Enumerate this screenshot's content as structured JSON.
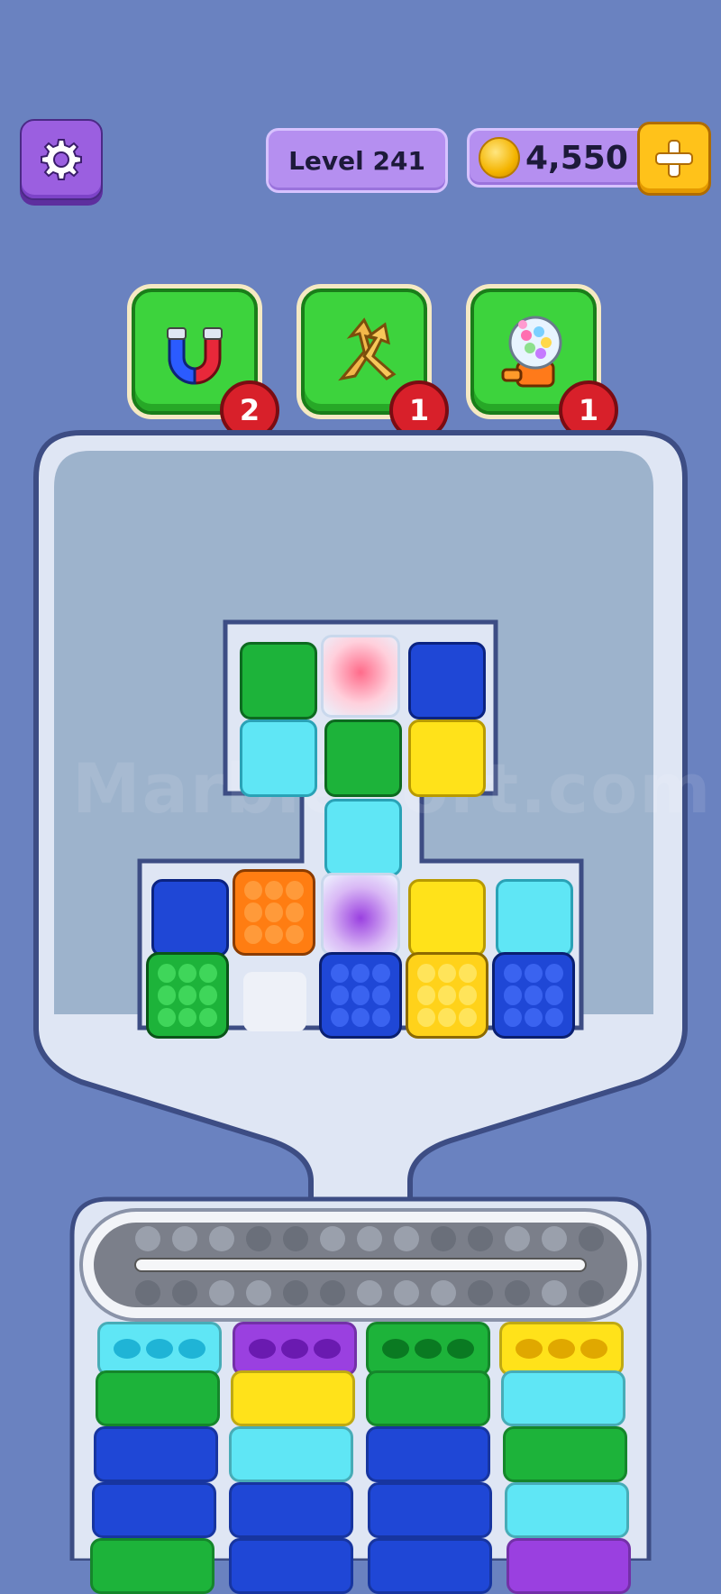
{
  "hud": {
    "level_label": "Level 241",
    "coins": "4,550",
    "plus_symbol": "+"
  },
  "boosters": [
    {
      "name": "magnet",
      "count": "2"
    },
    {
      "name": "shuffle",
      "count": "1"
    },
    {
      "name": "gumball-machine",
      "count": "1"
    }
  ],
  "watermark": "MarbleSort.com",
  "colors": {
    "background": "#6a82c0",
    "green": "#1db33a",
    "blue": "#1f47d6",
    "cyan": "#5fe6f5",
    "yellow": "#ffe21a",
    "orange": "#ff7d12",
    "purple": "#9a40e0"
  }
}
